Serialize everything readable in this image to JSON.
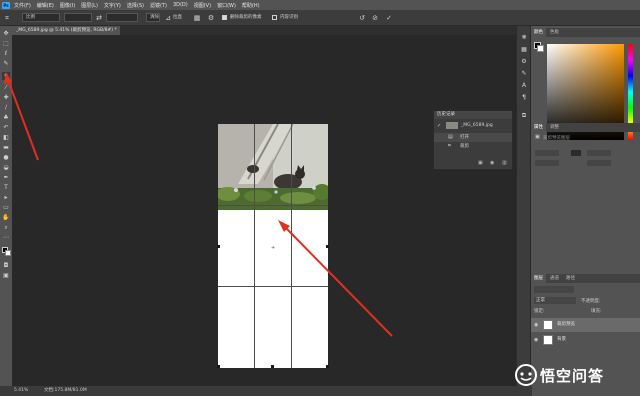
{
  "app": {
    "logo": "Ps"
  },
  "menu": [
    "文件(F)",
    "编辑(E)",
    "图像(I)",
    "图层(L)",
    "文字(Y)",
    "选择(S)",
    "滤镜(T)",
    "3D(D)",
    "视图(V)",
    "窗口(W)",
    "帮助(H)"
  ],
  "options": {
    "ratio_value": "比例",
    "clear_label": "清除",
    "straighten_label": "拉直",
    "delete_cropped_label": "删除裁剪的像素",
    "content_aware_label": "内容识别"
  },
  "document_tab": "_MG_6589.jpg @ 5.41% (裁剪预览, RGB/8#) *",
  "status": {
    "zoom": "5.41%",
    "doc_info": "文档:175.8M/81.0M"
  },
  "history": {
    "title": "历史记录",
    "snapshot": "_MG_6589.jpg",
    "items": [
      "打开",
      "裁剪"
    ]
  },
  "panels": {
    "color_tab": "颜色",
    "swatches_tab": "色板",
    "properties_tab": "属性",
    "adjustments_tab": "调整",
    "properties_label": "裁剪预览图层",
    "layers_tab": "图层",
    "channels_tab": "通道",
    "paths_tab": "路径",
    "blend_mode": "正常",
    "opacity_label": "不透明度:",
    "lock_label": "锁定:",
    "fill_label": "填充:"
  },
  "layers": [
    {
      "name": "裁剪预览"
    },
    {
      "name": "背景"
    }
  ],
  "watermark": {
    "text": "悟空问答"
  },
  "colors": {
    "accent_arrow": "#e0301e",
    "ps_blue": "#31a8ff"
  }
}
